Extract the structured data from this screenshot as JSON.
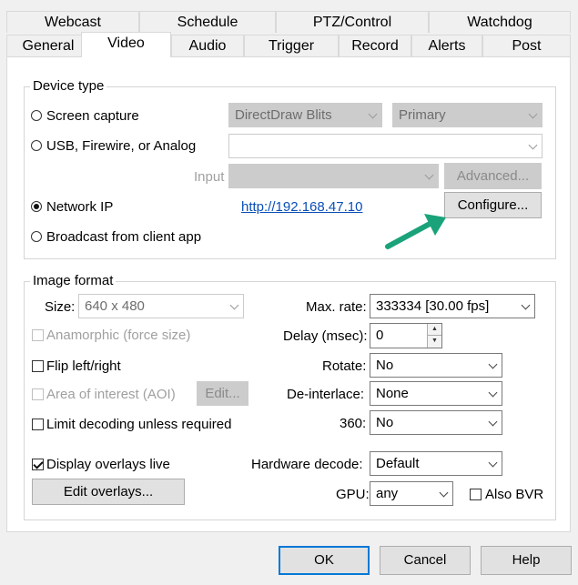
{
  "tabs_row1": [
    "Webcast",
    "Schedule",
    "PTZ/Control",
    "Watchdog"
  ],
  "tabs_row2": [
    "General",
    "Video",
    "Audio",
    "Trigger",
    "Record",
    "Alerts",
    "Post"
  ],
  "active_tab": "Video",
  "device_type": {
    "title": "Device type",
    "screen_capture": "Screen capture",
    "screen_capture_method": "DirectDraw Blits",
    "screen_capture_monitor": "Primary",
    "usb": "USB, Firewire, or Analog",
    "usb_device": "",
    "input_label": "Input",
    "input_value": "",
    "advanced_button": "Advanced...",
    "network_ip": "Network IP",
    "network_ip_selected": true,
    "network_url": "http://192.168.47.10",
    "configure_button": "Configure...",
    "broadcast": "Broadcast from client app"
  },
  "image_format": {
    "title": "Image format",
    "size_label": "Size:",
    "size_value": "640 x 480",
    "anamorphic": "Anamorphic (force size)",
    "flip": "Flip left/right",
    "aoi": "Area of interest (AOI)",
    "edit_button": "Edit...",
    "limit_decoding": "Limit decoding unless required",
    "display_overlays": "Display overlays live",
    "display_overlays_checked": true,
    "edit_overlays_button": "Edit overlays...",
    "max_rate_label": "Max. rate:",
    "max_rate_value": "333334 [30.00 fps]",
    "delay_label": "Delay (msec):",
    "delay_value": "0",
    "rotate_label": "Rotate:",
    "rotate_value": "No",
    "deinterlace_label": "De-interlace:",
    "deinterlace_value": "None",
    "three60_label": "360:",
    "three60_value": "No",
    "hw_decode_label": "Hardware decode:",
    "hw_decode_value": "Default",
    "gpu_label": "GPU:",
    "gpu_value": "any",
    "also_bvr": "Also BVR"
  },
  "footer": {
    "ok": "OK",
    "cancel": "Cancel",
    "help": "Help"
  },
  "colors": {
    "arrow": "#1aa37a",
    "link": "#0a4fb8",
    "default_button_border": "#0078d7"
  }
}
